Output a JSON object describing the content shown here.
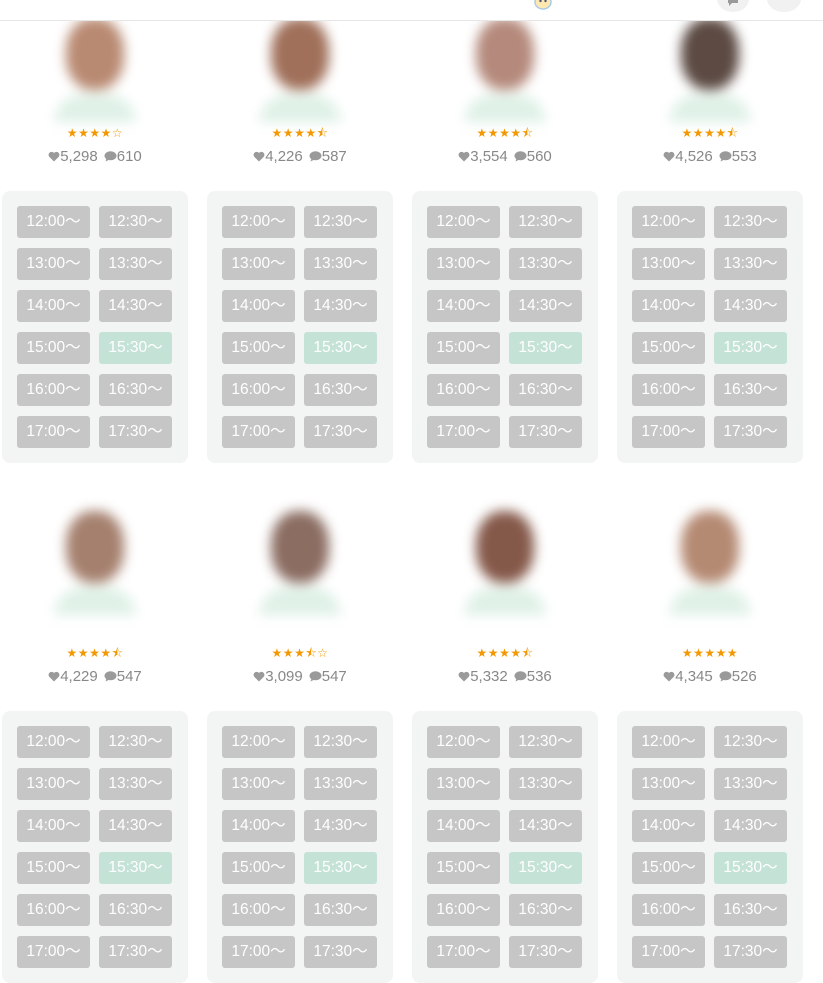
{
  "colors": {
    "slot_closed": "#c6c6c6",
    "slot_open": "#c4e3d6",
    "panel_bg": "#f3f4f4",
    "star": "#f39800",
    "stat_text": "#888888"
  },
  "teachers": [
    {
      "rating": 4.0,
      "stars": "★★★★☆",
      "likes": "5,298",
      "comments": "610",
      "skin": "#b98a72"
    },
    {
      "rating": 4.5,
      "stars": "★★★★⯪",
      "likes": "4,226",
      "comments": "587",
      "skin": "#a0705a"
    },
    {
      "rating": 4.5,
      "stars": "★★★★⯪",
      "likes": "3,554",
      "comments": "560",
      "skin": "#b58a7c"
    },
    {
      "rating": 4.5,
      "stars": "★★★★⯪",
      "likes": "4,526",
      "comments": "553",
      "skin": "#5c4a43"
    },
    {
      "rating": 4.5,
      "stars": "★★★★⯪",
      "likes": "4,229",
      "comments": "547",
      "skin": "#a5806e"
    },
    {
      "rating": 3.5,
      "stars": "★★★⯪☆",
      "likes": "3,099",
      "comments": "547",
      "skin": "#8b6d62"
    },
    {
      "rating": 4.5,
      "stars": "★★★★⯪",
      "likes": "5,332",
      "comments": "536",
      "skin": "#85594a"
    },
    {
      "rating": 5.0,
      "stars": "★★★★★",
      "likes": "4,345",
      "comments": "526",
      "skin": "#b58a73"
    }
  ],
  "time_slots": [
    {
      "label": "12:00〜",
      "open": false
    },
    {
      "label": "12:30〜",
      "open": false
    },
    {
      "label": "13:00〜",
      "open": false
    },
    {
      "label": "13:30〜",
      "open": false
    },
    {
      "label": "14:00〜",
      "open": false
    },
    {
      "label": "14:30〜",
      "open": false
    },
    {
      "label": "15:00〜",
      "open": false
    },
    {
      "label": "15:30〜",
      "open": true
    },
    {
      "label": "16:00〜",
      "open": false
    },
    {
      "label": "16:30〜",
      "open": false
    },
    {
      "label": "17:00〜",
      "open": false
    },
    {
      "label": "17:30〜",
      "open": false
    }
  ],
  "icons": {
    "like": "heart-icon",
    "comment": "speech-bubble-icon",
    "header_left": "chat-icon",
    "header_right": "user-icon"
  }
}
